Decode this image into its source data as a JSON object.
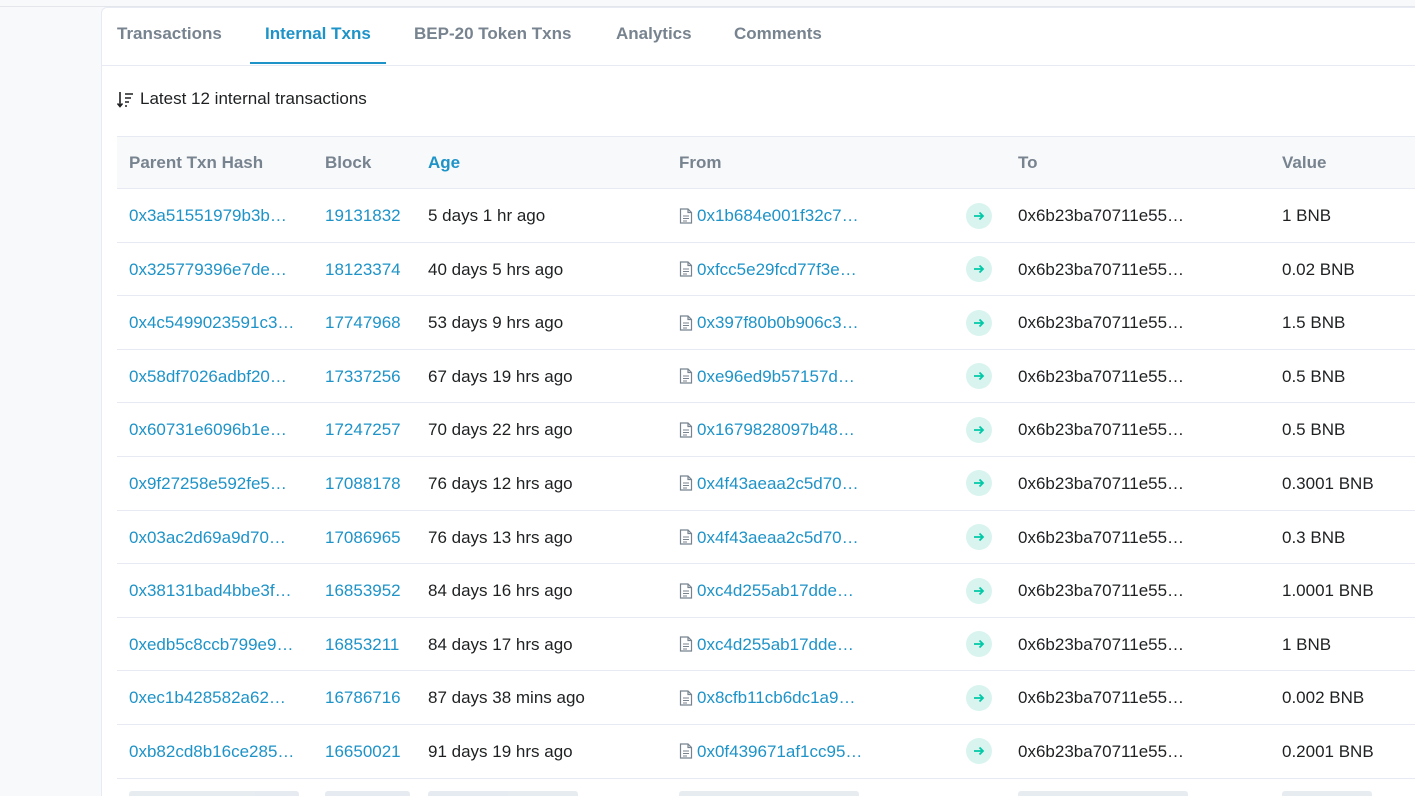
{
  "tabs": [
    {
      "label": "Transactions",
      "active": false
    },
    {
      "label": "Internal Txns",
      "active": true
    },
    {
      "label": "BEP-20 Token Txns",
      "active": false
    },
    {
      "label": "Analytics",
      "active": false
    },
    {
      "label": "Comments",
      "active": false
    }
  ],
  "summary": {
    "text": "Latest 12 internal transactions",
    "icon": "sort-desc-icon"
  },
  "columns": {
    "parent_txn_hash": "Parent Txn Hash",
    "block": "Block",
    "age": "Age",
    "from": "From",
    "to": "To",
    "value": "Value"
  },
  "rows": [
    {
      "hash": "0x3a51551979b3b…",
      "block": "19131832",
      "age": "5 days 1 hr ago",
      "from": "0x1b684e001f32c7…",
      "to": "0x6b23ba70711e55…",
      "value": "1 BNB"
    },
    {
      "hash": "0x325779396e7de…",
      "block": "18123374",
      "age": "40 days 5 hrs ago",
      "from": "0xfcc5e29fcd77f3e…",
      "to": "0x6b23ba70711e55…",
      "value": "0.02 BNB"
    },
    {
      "hash": "0x4c5499023591c3…",
      "block": "17747968",
      "age": "53 days 9 hrs ago",
      "from": "0x397f80b0b906c3…",
      "to": "0x6b23ba70711e55…",
      "value": "1.5 BNB"
    },
    {
      "hash": "0x58df7026adbf20…",
      "block": "17337256",
      "age": "67 days 19 hrs ago",
      "from": "0xe96ed9b57157d…",
      "to": "0x6b23ba70711e55…",
      "value": "0.5 BNB"
    },
    {
      "hash": "0x60731e6096b1e…",
      "block": "17247257",
      "age": "70 days 22 hrs ago",
      "from": "0x1679828097b48…",
      "to": "0x6b23ba70711e55…",
      "value": "0.5 BNB"
    },
    {
      "hash": "0x9f27258e592fe5…",
      "block": "17088178",
      "age": "76 days 12 hrs ago",
      "from": "0x4f43aeaa2c5d70…",
      "to": "0x6b23ba70711e55…",
      "value": "0.3001 BNB"
    },
    {
      "hash": "0x03ac2d69a9d70…",
      "block": "17086965",
      "age": "76 days 13 hrs ago",
      "from": "0x4f43aeaa2c5d70…",
      "to": "0x6b23ba70711e55…",
      "value": "0.3 BNB"
    },
    {
      "hash": "0x38131bad4bbe3f…",
      "block": "16853952",
      "age": "84 days 16 hrs ago",
      "from": "0xc4d255ab17dde…",
      "to": "0x6b23ba70711e55…",
      "value": "1.0001 BNB"
    },
    {
      "hash": "0xedb5c8ccb799e9…",
      "block": "16853211",
      "age": "84 days 17 hrs ago",
      "from": "0xc4d255ab17dde…",
      "to": "0x6b23ba70711e55…",
      "value": "1 BNB"
    },
    {
      "hash": "0xec1b428582a62…",
      "block": "16786716",
      "age": "87 days 38 mins ago",
      "from": "0x8cfb11cb6dc1a9…",
      "to": "0x6b23ba70711e55…",
      "value": "0.002 BNB"
    },
    {
      "hash": "0xb82cd8b16ce285…",
      "block": "16650021",
      "age": "91 days 19 hrs ago",
      "from": "0x0f439671af1cc95…",
      "to": "0x6b23ba70711e55…",
      "value": "0.2001 BNB"
    }
  ],
  "icons": {
    "from_contract": "contract-file-icon",
    "direction": "arrow-right-icon"
  },
  "colors": {
    "link": "#1e93c8",
    "muted": "#77838f",
    "text": "#1e2022",
    "arrow_badge_bg": "#d9f4ef",
    "arrow": "#00c9a7"
  }
}
